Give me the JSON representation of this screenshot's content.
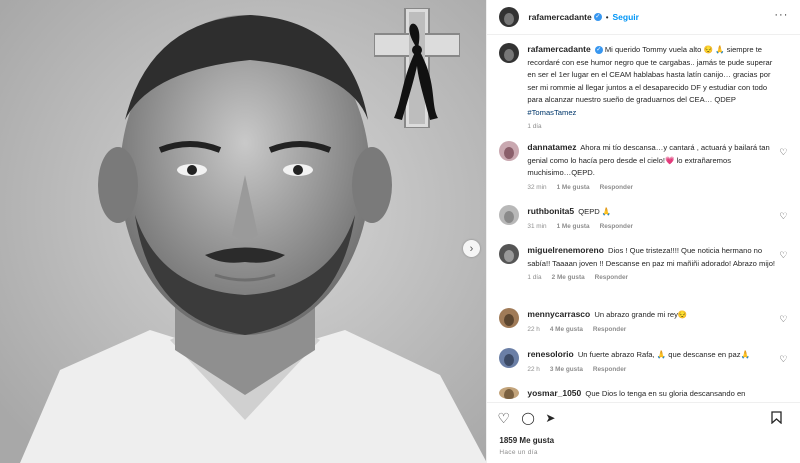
{
  "post": {
    "author": "rafamercadante",
    "follow_label": "Seguir",
    "separator": "•",
    "more_label": "···",
    "caption": "Mi querido Tommy vuela alto 😔 🙏 siempre te recordaré con ese humor negro que te cargabas.. jamás te pude superar en ser el 1er lugar en el CEAM hablabas hasta latín canijo… gracias por ser mi rommie al llegar juntos a el desaparecido DF y estudiar con todo para alcanzar nuestro sueño de graduarnos del CEA… QDEP",
    "caption_tag": "#TomasTamez",
    "caption_time": "1 día",
    "likes": "1859 Me gusta",
    "time_ago": "Hace un día",
    "next_icon": "chevron-right-icon"
  },
  "comments": [
    {
      "user": "dannatamez",
      "text": "Ahora mi tío descansa…y cantará , actuará y bailará tan genial como lo hacía pero desde el cielo!💗 lo extrañaremos muchisimo…QEPD.",
      "time": "32 min",
      "likes": "1 Me gusta",
      "reply": "Responder"
    },
    {
      "user": "ruthbonita5",
      "text": "QEPD 🙏",
      "time": "31 min",
      "likes": "1 Me gusta",
      "reply": "Responder"
    },
    {
      "user": "miguelrenemoreno",
      "text": "Dios ! Que tristeza!!!! Que noticia hermano no sabía!! Taaaan joven !! Descanse en paz mi mañiñi adorado! Abrazo mijo!",
      "time": "1 día",
      "likes": "2 Me gusta",
      "reply": "Responder"
    },
    {
      "user": "mennycarrasco",
      "text": "Un abrazo grande mi rey😔",
      "time": "22 h",
      "likes": "4 Me gusta",
      "reply": "Responder"
    },
    {
      "user": "renesolorio",
      "text": "Un fuerte abrazo Rafa, 🙏 que descanse en paz🙏",
      "time": "22 h",
      "likes": "3 Me gusta",
      "reply": "Responder"
    },
    {
      "user": "yosmar_1050",
      "text": "Que Dios lo tenga en su gloria descansando en",
      "time": "",
      "likes": "",
      "reply": ""
    }
  ],
  "icons": {
    "like": "heart-icon",
    "comment": "comment-icon",
    "share": "share-icon",
    "save": "bookmark-icon",
    "more": "more-icon",
    "mourning": "mourning-ribbon-cross-icon"
  },
  "colors": {
    "accent": "#0095f6",
    "verified": "#3897f0",
    "text": "#262626",
    "muted": "#8e8e8e",
    "border": "#efefef"
  }
}
